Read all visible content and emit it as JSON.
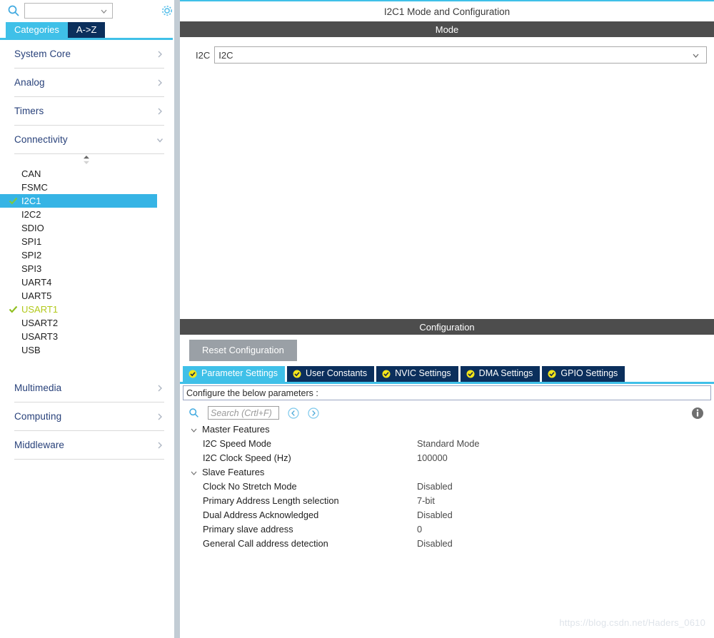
{
  "sidebar": {
    "search": {
      "value": "",
      "placeholder": "",
      "icon": "search-icon"
    },
    "gear_icon": "gear-icon",
    "tabs": [
      {
        "label": "Categories",
        "active": true
      },
      {
        "label": "A->Z",
        "active": false
      }
    ],
    "categories": [
      {
        "label": "System Core",
        "expanded": false
      },
      {
        "label": "Analog",
        "expanded": false
      },
      {
        "label": "Timers",
        "expanded": false
      },
      {
        "label": "Connectivity",
        "expanded": true
      }
    ],
    "peripherals": [
      {
        "label": "CAN",
        "state": "none"
      },
      {
        "label": "FSMC",
        "state": "none"
      },
      {
        "label": "I2C1",
        "state": "selected"
      },
      {
        "label": "I2C2",
        "state": "none"
      },
      {
        "label": "SDIO",
        "state": "none"
      },
      {
        "label": "SPI1",
        "state": "none"
      },
      {
        "label": "SPI2",
        "state": "none"
      },
      {
        "label": "SPI3",
        "state": "none"
      },
      {
        "label": "UART4",
        "state": "none"
      },
      {
        "label": "UART5",
        "state": "none"
      },
      {
        "label": "USART1",
        "state": "enabled"
      },
      {
        "label": "USART2",
        "state": "none"
      },
      {
        "label": "USART3",
        "state": "none"
      },
      {
        "label": "USB",
        "state": "none"
      }
    ],
    "categories_bottom": [
      {
        "label": "Multimedia",
        "expanded": false
      },
      {
        "label": "Computing",
        "expanded": false
      },
      {
        "label": "Middleware",
        "expanded": false
      }
    ]
  },
  "main": {
    "title": "I2C1 Mode and Configuration",
    "mode_section_title": "Mode",
    "mode": {
      "label": "I2C",
      "selected_value": "I2C"
    },
    "config_section_title": "Configuration",
    "reset_button": "Reset Configuration",
    "tabs": [
      {
        "label": "Parameter Settings",
        "active": true
      },
      {
        "label": "User Constants",
        "active": false
      },
      {
        "label": "NVIC Settings",
        "active": false
      },
      {
        "label": "DMA Settings",
        "active": false
      },
      {
        "label": "GPIO Settings",
        "active": false
      }
    ],
    "hint": "Configure the below parameters :",
    "param_search": {
      "placeholder": "Search (Crtl+F)",
      "value": ""
    },
    "groups": [
      {
        "label": "Master Features",
        "expanded": true,
        "rows": [
          {
            "name": "I2C Speed Mode",
            "value": "Standard Mode"
          },
          {
            "name": "I2C Clock Speed (Hz)",
            "value": "100000"
          }
        ]
      },
      {
        "label": "Slave Features",
        "expanded": true,
        "rows": [
          {
            "name": "Clock No Stretch Mode",
            "value": "Disabled"
          },
          {
            "name": "Primary Address Length selection",
            "value": "7-bit"
          },
          {
            "name": "Dual Address Acknowledged",
            "value": "Disabled"
          },
          {
            "name": "Primary slave address",
            "value": "0"
          },
          {
            "name": "General Call address detection",
            "value": "Disabled"
          }
        ]
      }
    ]
  },
  "watermark": "https://blog.csdn.net/Haders_0610",
  "colors": {
    "accent_cyan": "#3fc0e8",
    "tab_navy": "#0b2f5c",
    "section_gray": "#4d4d4d",
    "enabled_green": "#b2c91b",
    "check_green": "#7ac943",
    "reset_gray": "#9aa0a6"
  }
}
